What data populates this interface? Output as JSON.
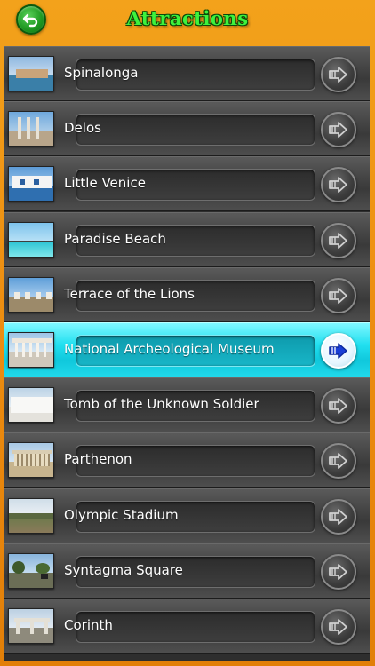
{
  "header": {
    "title": "Attractions",
    "back_icon": "back-arrow-icon"
  },
  "colors": {
    "background": "#ec8c10",
    "title": "#3df23d",
    "row": "#444444",
    "selected_row": "#22e0f0",
    "selected_arrow": "#1a3fd6"
  },
  "attractions": [
    {
      "name": "Spinalonga",
      "selected": false
    },
    {
      "name": "Delos",
      "selected": false
    },
    {
      "name": "Little Venice",
      "selected": false
    },
    {
      "name": "Paradise Beach",
      "selected": false
    },
    {
      "name": "Terrace of the Lions",
      "selected": false
    },
    {
      "name": "National Archeological Museum",
      "selected": true
    },
    {
      "name": "Tomb of the Unknown Soldier",
      "selected": false
    },
    {
      "name": "Parthenon",
      "selected": false
    },
    {
      "name": "Olympic Stadium",
      "selected": false
    },
    {
      "name": "Syntagma Square",
      "selected": false
    },
    {
      "name": "Corinth",
      "selected": false
    }
  ]
}
